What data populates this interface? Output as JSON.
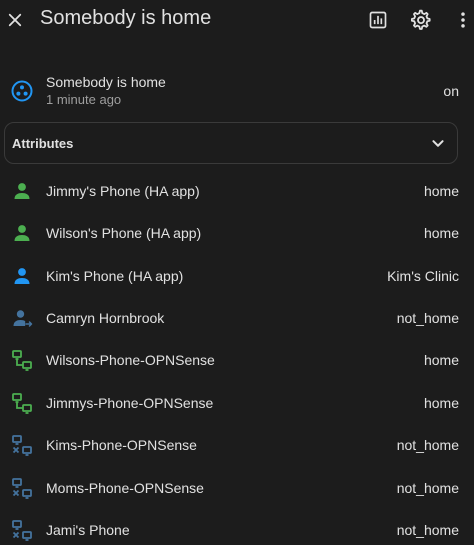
{
  "header": {
    "title": "Somebody is home"
  },
  "state": {
    "name": "Somebody is home",
    "last_changed": "1 minute ago",
    "value": "on"
  },
  "attributes": {
    "label": "Attributes"
  },
  "entities": [
    {
      "name": "Jimmy's Phone (HA app)",
      "state": "home",
      "icon": "person-icon",
      "color": "#4caf50"
    },
    {
      "name": "Wilson's Phone (HA app)",
      "state": "home",
      "icon": "person-icon",
      "color": "#4caf50"
    },
    {
      "name": "Kim's Phone (HA app)",
      "state": "Kim's Clinic",
      "icon": "person-icon",
      "color": "#2196f3"
    },
    {
      "name": "Camryn Hornbrook",
      "state": "not_home",
      "icon": "person-away-icon",
      "color": "#44739e"
    },
    {
      "name": "Wilsons-Phone-OPNSense",
      "state": "home",
      "icon": "lan-connect-icon",
      "color": "#4caf50"
    },
    {
      "name": "Jimmys-Phone-OPNSense",
      "state": "home",
      "icon": "lan-connect-icon",
      "color": "#4caf50"
    },
    {
      "name": "Kims-Phone-OPNSense",
      "state": "not_home",
      "icon": "lan-disconnect-icon",
      "color": "#44739e"
    },
    {
      "name": "Moms-Phone-OPNSense",
      "state": "not_home",
      "icon": "lan-disconnect-icon",
      "color": "#44739e"
    },
    {
      "name": "Jami's Phone",
      "state": "not_home",
      "icon": "lan-disconnect-icon",
      "color": "#44739e"
    }
  ],
  "colors": {
    "background": "#1c1c1c",
    "state_icon": "#2196f3"
  }
}
